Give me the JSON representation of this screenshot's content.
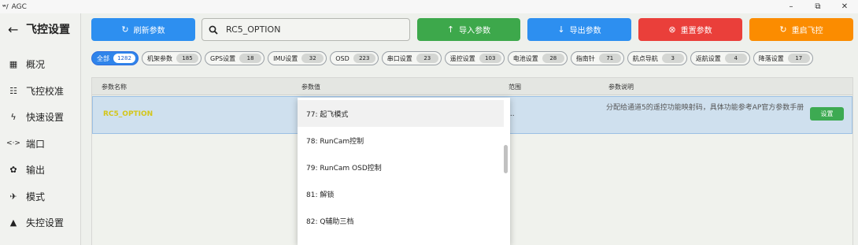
{
  "window": {
    "logo": "ʷ/",
    "title": "AGC",
    "min": "–",
    "max": "⧉",
    "close": "✕"
  },
  "sidebar": {
    "title": "飞控设置",
    "back_glyph": "←",
    "items": [
      {
        "label": "概况",
        "glyph": "▦"
      },
      {
        "label": "飞控校准",
        "glyph": "☷"
      },
      {
        "label": "快速设置",
        "glyph": "ϟ"
      },
      {
        "label": "端口",
        "glyph": "<·>"
      },
      {
        "label": "输出",
        "glyph": "✿"
      },
      {
        "label": "模式",
        "glyph": "✈"
      },
      {
        "label": "失控设置",
        "glyph": "▲"
      }
    ]
  },
  "toolbar": {
    "refresh": {
      "label": "刷新参数",
      "glyph": "↻",
      "color": "#2d8ff0"
    },
    "search_value": "RC5_OPTION",
    "import": {
      "label": "导入参数",
      "glyph": "↑",
      "color": "#3da84b"
    },
    "export": {
      "label": "导出参数",
      "glyph": "↓",
      "color": "#2d8ff0"
    },
    "reset": {
      "label": "重置参数",
      "glyph": "⊗",
      "color": "#ea3f3a"
    },
    "reboot": {
      "label": "重启飞控",
      "glyph": "↻",
      "color": "#fb8c00"
    }
  },
  "categories": [
    {
      "label": "全部",
      "count": "1282",
      "active": true
    },
    {
      "label": "机架参数",
      "count": "185"
    },
    {
      "label": "GPS设置",
      "count": "18"
    },
    {
      "label": "IMU设置",
      "count": "32"
    },
    {
      "label": "OSD",
      "count": "223"
    },
    {
      "label": "串口设置",
      "count": "23"
    },
    {
      "label": "遥控设置",
      "count": "103"
    },
    {
      "label": "电池设置",
      "count": "28"
    },
    {
      "label": "指南针",
      "count": "71"
    },
    {
      "label": "航点导航",
      "count": "3"
    },
    {
      "label": "返航设置",
      "count": "4"
    },
    {
      "label": "降落设置",
      "count": "17"
    }
  ],
  "table": {
    "headers": {
      "name": "参数名称",
      "value": "参数值",
      "range": "范围",
      "desc": "参数说明"
    },
    "row": {
      "name": "RC5_OPTION",
      "range": "...",
      "desc": "分配给通道5的遥控功能映射码，具体功能参考AP官方参数手册",
      "set_label": "设置"
    }
  },
  "dropdown": {
    "options": [
      "77: 起飞模式",
      "78: RunCam控制",
      "79: RunCam OSD控制",
      "81: 解锁",
      "82: Q辅助三档"
    ]
  },
  "colors": {
    "accent": "#2f84ea",
    "set_button": "#3daa52",
    "highlight_text": "#d4c619"
  }
}
